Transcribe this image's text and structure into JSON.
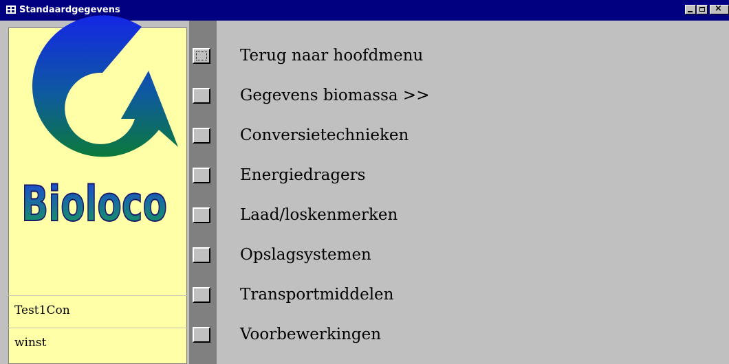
{
  "window": {
    "title": "Standaardgegevens",
    "icon": "form-icon",
    "controls": [
      "minimize-icon",
      "maximize-icon",
      "close-icon"
    ]
  },
  "logo": {
    "text": "Bioloco"
  },
  "fields": {
    "name": "Test1Con",
    "type": "winst"
  },
  "menu": {
    "items": [
      {
        "label": "Terug naar hoofdmenu"
      },
      {
        "label": "Gegevens biomassa >>"
      },
      {
        "label": "Conversietechnieken"
      },
      {
        "label": "Energiedragers"
      },
      {
        "label": "Laad/loskenmerken"
      },
      {
        "label": "Opslagsystemen"
      },
      {
        "label": "Transportmiddelen"
      },
      {
        "label": "Voorbewerkingen"
      }
    ]
  },
  "colors": {
    "titlebar": "#000080",
    "panel": "#ffffa8",
    "face": "#c0c0c0",
    "logo_top": "#1426e6",
    "logo_bottom": "#0b7a3a"
  }
}
